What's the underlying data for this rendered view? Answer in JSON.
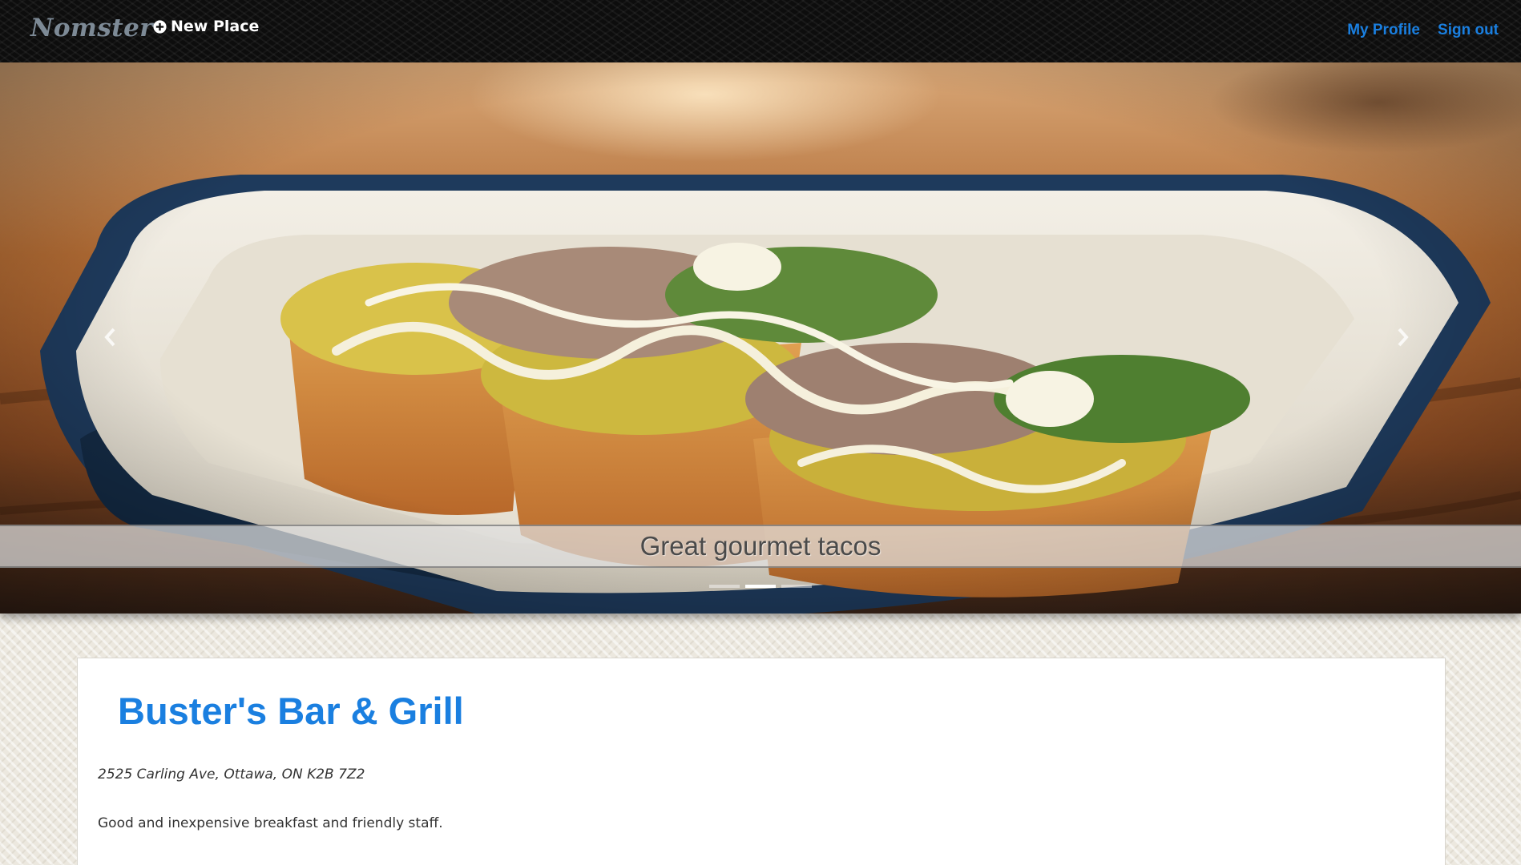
{
  "navbar": {
    "brand": "Nomster",
    "new_place_label": "New Place",
    "new_place_icon": "plus-circle-icon",
    "my_profile_label": "My Profile",
    "sign_out_label": "Sign out",
    "link_color": "#1a7fe0"
  },
  "carousel": {
    "caption": "Great gourmet tacos",
    "slide_count": 3,
    "active_slide": 2,
    "prev_icon": "chevron-left-icon",
    "next_icon": "chevron-right-icon"
  },
  "place": {
    "name": "Buster's Bar & Grill",
    "address": "2525 Carling Ave, Ottawa, ON K2B 7Z2",
    "description": "Good and inexpensive breakfast and friendly staff."
  }
}
